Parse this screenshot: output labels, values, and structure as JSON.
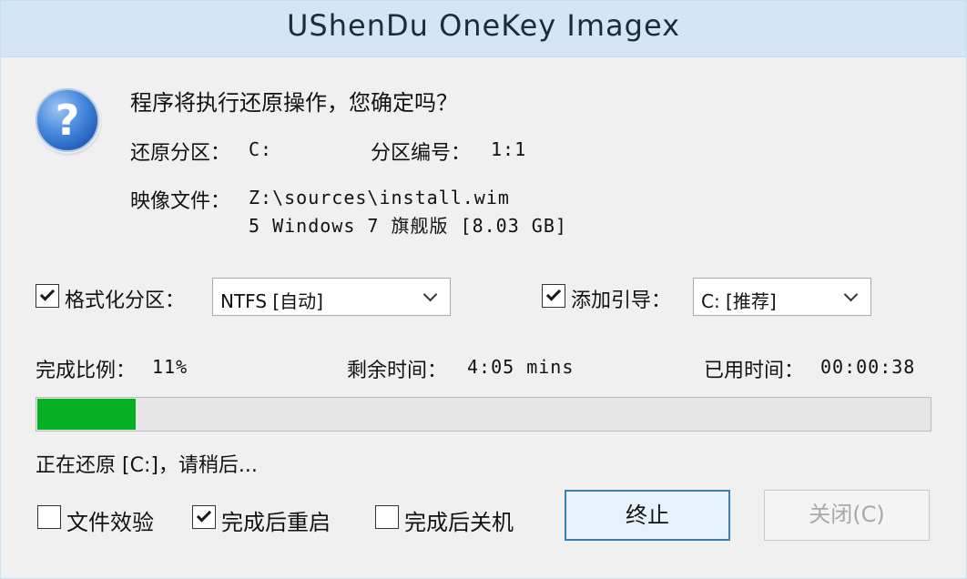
{
  "window": {
    "title": "UShenDu OneKey Imagex"
  },
  "dialog": {
    "icon": "question-icon",
    "question": "程序将执行还原操作，您确定吗？",
    "restore_partition_label": "还原分区：",
    "restore_partition_value": "C:",
    "partition_number_label": "分区编号：",
    "partition_number_value": "1:1",
    "image_file_label": "映像文件：",
    "image_file_path": "Z:\\sources\\install.wim",
    "image_file_detail": "5 Windows 7 旗舰版 [8.03 GB]"
  },
  "options": {
    "format_partition": {
      "label": "格式化分区：",
      "checked": true
    },
    "format_select": {
      "value": "NTFS [自动]"
    },
    "add_boot": {
      "label": "添加引导：",
      "checked": true
    },
    "boot_select": {
      "value": "C: [推荐]"
    }
  },
  "progress": {
    "percent_label": "完成比例：",
    "percent_text": "11%",
    "percent_value": 11,
    "remaining_label": "剩余时间：",
    "remaining_value": "4:05 mins",
    "elapsed_label": "已用时间：",
    "elapsed_value": "00:00:38",
    "status_text": "正在还原 [C:]，请稍后...",
    "fill_color": "#06b025"
  },
  "footer": {
    "verify_files": {
      "label": "文件效验",
      "checked": false
    },
    "restart_after": {
      "label": "完成后重启",
      "checked": true
    },
    "shutdown_after": {
      "label": "完成后关机",
      "checked": false
    },
    "stop_button": "终止",
    "close_button": "关闭(C)"
  }
}
